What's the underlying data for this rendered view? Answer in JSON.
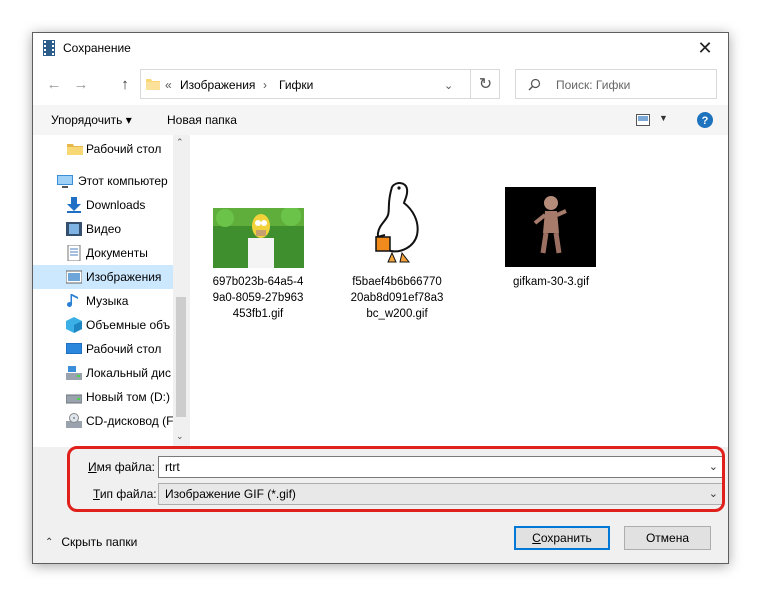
{
  "window": {
    "title": "Сохранение"
  },
  "address": {
    "prefix": "«",
    "crumbs": [
      "Изображения",
      "Гифки"
    ],
    "search_placeholder": "Поиск: Гифки"
  },
  "toolbar": {
    "organize": "Упорядочить ▾",
    "new_folder": "Новая папка"
  },
  "nav": [
    {
      "label": "Рабочий стол",
      "icon": "folder-icon"
    },
    {
      "label": "Этот компьютер",
      "icon": "computer-icon"
    },
    {
      "label": "Downloads",
      "icon": "download-icon"
    },
    {
      "label": "Видео",
      "icon": "video-icon"
    },
    {
      "label": "Документы",
      "icon": "document-icon"
    },
    {
      "label": "Изображения",
      "icon": "pictures-icon",
      "selected": true
    },
    {
      "label": "Музыка",
      "icon": "music-icon"
    },
    {
      "label": "Объемные объ",
      "icon": "3d-objects-icon"
    },
    {
      "label": "Рабочий стол",
      "icon": "desktop-icon"
    },
    {
      "label": "Локальный дис",
      "icon": "local-disk-icon"
    },
    {
      "label": "Новый том (D:)",
      "icon": "drive-icon"
    },
    {
      "label": "CD-дисковод (F",
      "icon": "cd-drive-icon"
    }
  ],
  "files": [
    {
      "name_lines": [
        "697b023b-64a5-4",
        "9a0-8059-27b963",
        "453fb1.gif"
      ]
    },
    {
      "name_lines": [
        "f5baef4b6b66770",
        "20ab8d091ef78a3",
        "bc_w200.gif"
      ]
    },
    {
      "name_lines": [
        "gifkam-30-3.gif"
      ]
    }
  ],
  "form": {
    "filename_label_u": "И",
    "filename_label_rest": "мя файла:",
    "filename_value": "rtrt",
    "filetype_label_u": "Т",
    "filetype_label_rest": "ип файла:",
    "filetype_value": "Изображение GIF (*.gif)"
  },
  "footer": {
    "hide_folders": "Скрыть папки",
    "save_u": "С",
    "save_rest": "охранить",
    "cancel": "Отмена"
  },
  "colors": {
    "accent": "#0078d7",
    "highlight": "#e0201a",
    "selection": "#cce8ff"
  }
}
